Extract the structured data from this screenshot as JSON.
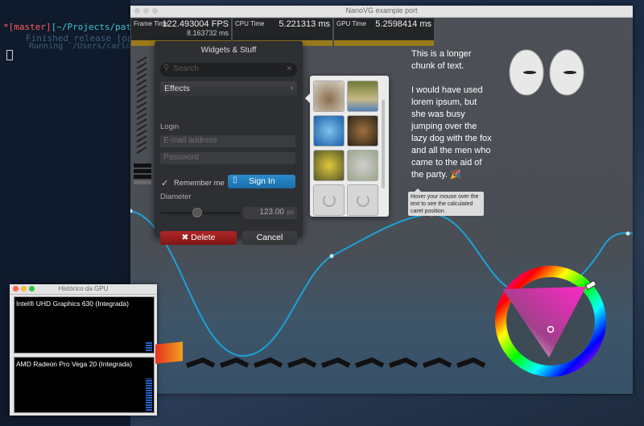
{
  "terminal": {
    "line1_star": "*",
    "line1_branch": "[master]",
    "line1_path": "[~/Projects/pathfin",
    "line2": "Finished release [optimi",
    "line3": "Running `/Users/carlos/"
  },
  "main_window": {
    "title": "NanoVG example port",
    "graphs": [
      {
        "name": "Frame Time",
        "value": "122.493004 FPS",
        "sub": "8.163732 ms"
      },
      {
        "name": "CPU Time",
        "value": "5.221313 ms"
      },
      {
        "name": "GPU Time",
        "value": "5.2598414 ms"
      }
    ],
    "panel": {
      "title": "Widgets & Stuff",
      "search_placeholder": "Search",
      "search_icon": "search-icon",
      "effects_label": "Effects",
      "login_label": "Login",
      "email_placeholder": "E-mail address",
      "password_placeholder": "Password",
      "remember_label": "Remember me",
      "signin_label": "Sign In",
      "diameter_label": "Diameter",
      "diameter_value": "123.00",
      "diameter_unit": "px",
      "delete_label": "Delete",
      "cancel_label": "Cancel"
    },
    "paragraph": "This is a longer chunk of text.\n\nI would have used lorem ipsum, but she was busy jumping over the lazy dog with the fox and all the men who came to the aid of the party. 🎉",
    "tooltip": "Hover your mouse over the text to see the calculated caret position."
  },
  "gpu_window": {
    "title": "Histórico da GPU",
    "gpu1": "Intel® UHD Graphics 630 (Integrada)",
    "gpu2": "AMD Radeon Pro Vega 20 (Integrada)"
  },
  "colors": {
    "accent_blue": "#1b6da8",
    "delete_red": "#b02626",
    "graph_bar": "#9b7a1a",
    "curve": "#1aa3d8"
  }
}
